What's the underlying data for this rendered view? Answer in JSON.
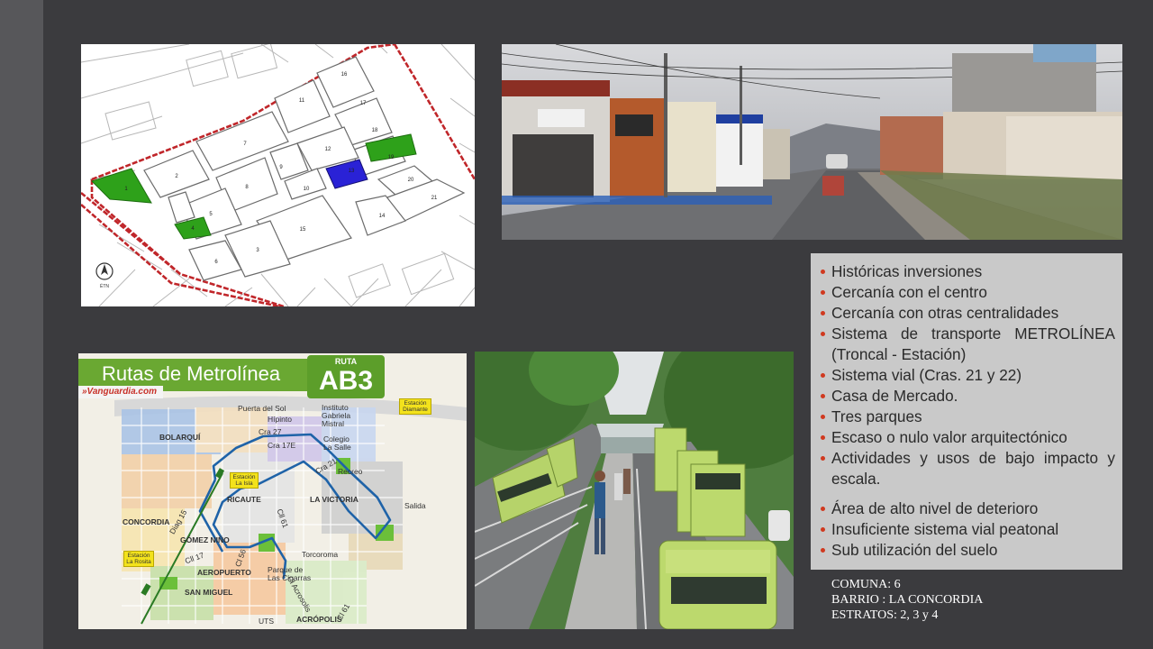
{
  "bullets": [
    "Históricas inversiones",
    "Cercanía con el centro",
    "Cercanía con otras centralidades",
    "Sistema de transporte METROLÍNEA (Troncal - Estación)",
    "Sistema vial (Cras. 21 y 22)",
    "Casa de Mercado.",
    "Tres parques",
    "Escaso o nulo valor arquitectónico",
    "Actividades y usos de bajo impacto y escala.",
    "Área de alto nivel de deterioro",
    "Insuficiente sistema vial peatonal",
    "Sub utilización del suelo"
  ],
  "caption": {
    "comuna": "COMUNA: 6",
    "barrio": "BARRIO : LA CONCORDIA",
    "estratos": "ESTRATOS: 2, 3 y 4"
  },
  "route_map": {
    "title": "Rutas de Metrolínea",
    "badge_label": "RUTA",
    "badge_code": "AB3",
    "source": "»Vanguardia.com",
    "labels": {
      "bolarqui": "BOLARQUÍ",
      "concordia": "CONCORDIA",
      "gomez_nino": "GÓMEZ NIÑO",
      "aeropuerto": "AEROPUERTO",
      "san_miguel": "SAN MIGUEL",
      "ricaute": "RICAUTE",
      "la_victoria": "LA VICTORIA",
      "acropolis": "ACRÓPOLIS",
      "puerta_del_sol": "Puerta del Sol",
      "hipinto": "Hípinto",
      "instituto": "Instituto Gabriela Mistral",
      "colegio": "Colegio La Salle",
      "parque": "Parque de Las Cigarras",
      "torcoroma": "Torcoroma",
      "salida": "Salida",
      "recreo": "Recreo",
      "uts": "UTS",
      "cra27": "Cra 27",
      "cra17e": "Cra 17E",
      "cra21": "Cra 21",
      "cll61": "Cll 61",
      "cl56": "Cl 56",
      "cll17": "Cll 17",
      "cl61b": "Cl 61",
      "diag15": "Diag 15",
      "cra_acrosolis": "Cl Acrosolis"
    },
    "stations": {
      "diamante": "Estación Diamante",
      "la_isla": "Estación La Isla",
      "la_rosita": "Estación La Rosita"
    }
  },
  "colors": {
    "background": "#3b3b3e",
    "bullet": "#d0391f",
    "park_green": "#2ea11a",
    "market_blue": "#2a22d6",
    "route_blue": "#1f63a8",
    "metrolinea_green": "#6aa832"
  },
  "icons": {
    "north_arrow": "north-arrow-icon"
  }
}
